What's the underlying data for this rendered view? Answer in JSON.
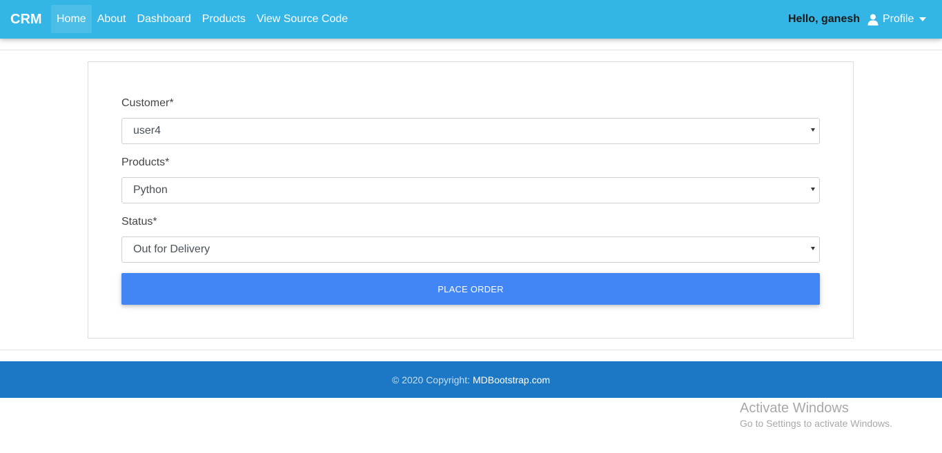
{
  "navbar": {
    "brand": "CRM",
    "links": [
      {
        "label": "Home",
        "active": true
      },
      {
        "label": "About"
      },
      {
        "label": "Dashboard"
      },
      {
        "label": "Products"
      },
      {
        "label": "View Source Code"
      }
    ],
    "greeting": "Hello, ganesh",
    "profile": {
      "label": "Profile",
      "icon": "user-icon"
    }
  },
  "form": {
    "customer": {
      "label": "Customer*",
      "value": "user4"
    },
    "products": {
      "label": "Products*",
      "value": "Python"
    },
    "status": {
      "label": "Status*",
      "value": "Out for Delivery"
    },
    "submit_label": "PLACE ORDER"
  },
  "footer": {
    "copyright": "© 2020 Copyright:",
    "link": "MDBootstrap.com"
  },
  "watermark": {
    "title": "Activate Windows",
    "subtitle": "Go to Settings to activate Windows."
  },
  "colors": {
    "navbar": "#33b5e5",
    "button": "#4285f4",
    "footer": "#1c78c4"
  }
}
